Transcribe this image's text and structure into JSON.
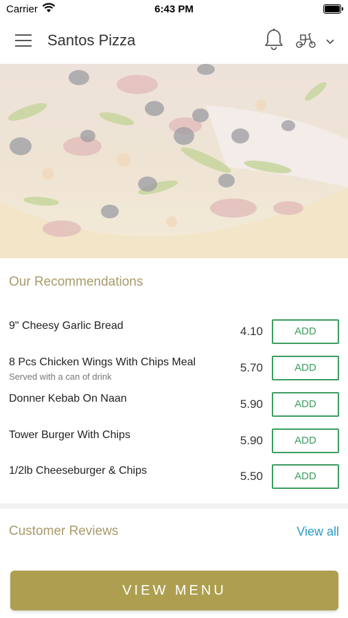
{
  "status_bar": {
    "carrier": "Carrier",
    "time": "6:43 PM"
  },
  "header": {
    "title": "Santos Pizza",
    "menu_icon": "hamburger-icon",
    "notification_icon": "bell-icon",
    "delivery_icon": "scooter-icon"
  },
  "recommendations": {
    "title": "Our Recommendations",
    "add_label": "ADD",
    "items": [
      {
        "name": "9\" Cheesy Garlic Bread",
        "subtitle": "",
        "price": "4.10"
      },
      {
        "name": "8 Pcs Chicken Wings With Chips Meal",
        "subtitle": "Served with a can of drink",
        "price": "5.70"
      },
      {
        "name": "Donner Kebab On Naan",
        "subtitle": "",
        "price": "5.90"
      },
      {
        "name": "Tower Burger With Chips",
        "subtitle": "",
        "price": "5.90"
      },
      {
        "name": "1/2lb Cheeseburger & Chips",
        "subtitle": "",
        "price": "5.50"
      }
    ]
  },
  "reviews": {
    "title": "Customer Reviews",
    "view_all": "View all"
  },
  "footer": {
    "view_menu_label": "VIEW MENU"
  },
  "colors": {
    "accent": "#ad9f4f",
    "section_title": "#a89a6a",
    "add_green": "#3a9d5d",
    "link_blue": "#2a9ac8"
  }
}
